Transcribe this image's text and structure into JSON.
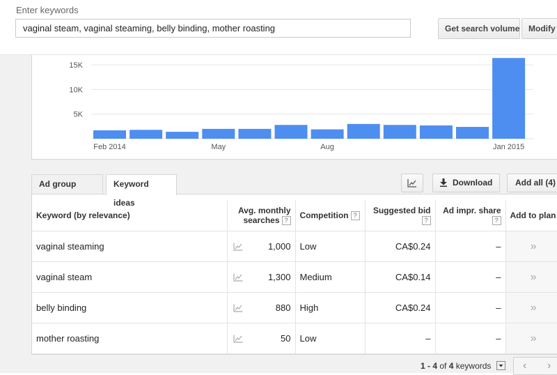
{
  "search": {
    "label": "Enter keywords",
    "value": "vaginal steam, vaginal steaming, belly binding, mother roasting",
    "get_volume_button": "Get search volume",
    "modify_button": "Modify s"
  },
  "chart_data": {
    "type": "bar",
    "y_ticks": [
      "5K",
      "10K",
      "15K"
    ],
    "x_tick_labels": [
      {
        "label": "Feb 2014",
        "index": 0
      },
      {
        "label": "May",
        "index": 3
      },
      {
        "label": "Aug",
        "index": 6
      },
      {
        "label": "Jan 2015",
        "index": 11
      }
    ],
    "values": [
      1700,
      1800,
      1400,
      2000,
      2000,
      2800,
      1900,
      3000,
      2800,
      2700,
      2400,
      16400
    ],
    "ylim": [
      0,
      17000
    ],
    "color": "#4d8ef0"
  },
  "tabs": {
    "ad_group": "Ad group ideas",
    "keyword": "Keyword ideas"
  },
  "actions": {
    "download": "Download",
    "add_all": "Add all (4)"
  },
  "table": {
    "headers": {
      "keyword": "Keyword (by relevance)",
      "avg_line1": "Avg. monthly",
      "avg_line2": "searches",
      "competition": "Competition",
      "bid_line1": "Suggested bid",
      "impr_line1": "Ad impr. share",
      "add": "Add to plan",
      "help": "?"
    },
    "rows": [
      {
        "keyword": "vaginal steaming",
        "searches": "1,000",
        "competition": "Low",
        "bid": "CA$0.24",
        "impr": "–",
        "add": "»"
      },
      {
        "keyword": "vaginal steam",
        "searches": "1,300",
        "competition": "Medium",
        "bid": "CA$0.14",
        "impr": "–",
        "add": "»"
      },
      {
        "keyword": "belly binding",
        "searches": "880",
        "competition": "High",
        "bid": "CA$0.24",
        "impr": "–",
        "add": "»"
      },
      {
        "keyword": "mother roasting",
        "searches": "50",
        "competition": "Low",
        "bid": "–",
        "impr": "–",
        "add": "»"
      }
    ]
  },
  "pager": {
    "range": "1 - 4",
    "of_text": "of",
    "total": "4",
    "unit": "keywords",
    "prev": "‹",
    "next": "›"
  }
}
